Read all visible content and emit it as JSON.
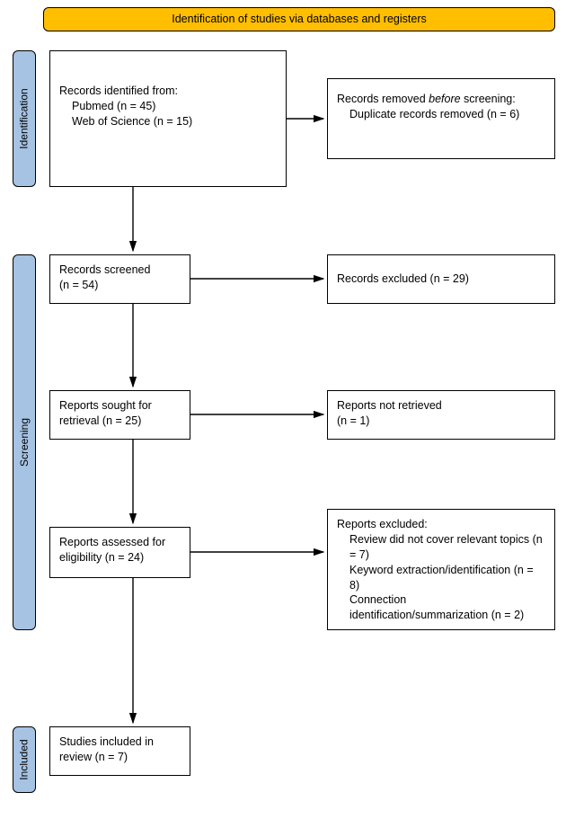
{
  "header": {
    "title": "Identification of studies via databases and registers"
  },
  "stages": {
    "identification": "Identification",
    "screening": "Screening",
    "included": "Included"
  },
  "boxes": {
    "identified": {
      "header": "Records identified from:",
      "line1": "Pubmed (n = 45)",
      "line2": "Web of Science (n = 15)"
    },
    "removed": {
      "line1_prefix": "Records removed ",
      "line1_em": "before",
      "line1_suffix": " screening:",
      "line2": "Duplicate records removed (n = 6)"
    },
    "screened": {
      "text": "Records screened",
      "count": "(n = 54)"
    },
    "excluded_screened": {
      "text": "Records excluded (n = 29)"
    },
    "sought": {
      "text": "Reports sought for retrieval (n = 25)"
    },
    "not_retrieved": {
      "text": "Reports not retrieved",
      "count": "(n = 1)"
    },
    "assessed": {
      "text": "Reports assessed for eligibility (n = 24)"
    },
    "excluded_assessed": {
      "header": "Reports excluded:",
      "r1": "Review did not cover relevant topics (n = 7)",
      "r2": "Keyword extraction/identification (n = 8)",
      "r3": "Connection identification/summarization (n = 2)"
    },
    "included": {
      "text": "Studies included in review (n = 7)"
    }
  },
  "chart_data": {
    "type": "diagram",
    "diagram_type": "PRISMA flow diagram",
    "title": "Identification of studies via databases and registers",
    "stages": [
      "Identification",
      "Screening",
      "Included"
    ],
    "nodes": [
      {
        "id": "identified",
        "stage": "Identification",
        "label": "Records identified from",
        "sources": [
          {
            "name": "Pubmed",
            "n": 45
          },
          {
            "name": "Web of Science",
            "n": 15
          }
        ]
      },
      {
        "id": "removed_before_screening",
        "stage": "Identification",
        "label": "Records removed before screening: Duplicate records removed",
        "n": 6
      },
      {
        "id": "screened",
        "stage": "Screening",
        "label": "Records screened",
        "n": 54
      },
      {
        "id": "excluded_screened",
        "stage": "Screening",
        "label": "Records excluded",
        "n": 29
      },
      {
        "id": "sought",
        "stage": "Screening",
        "label": "Reports sought for retrieval",
        "n": 25
      },
      {
        "id": "not_retrieved",
        "stage": "Screening",
        "label": "Reports not retrieved",
        "n": 1
      },
      {
        "id": "assessed",
        "stage": "Screening",
        "label": "Reports assessed for eligibility",
        "n": 24
      },
      {
        "id": "excluded_assessed",
        "stage": "Screening",
        "label": "Reports excluded",
        "reasons": [
          {
            "reason": "Review did not cover relevant topics",
            "n": 7
          },
          {
            "reason": "Keyword extraction/identification",
            "n": 8
          },
          {
            "reason": "Connection identification/summarization",
            "n": 2
          }
        ]
      },
      {
        "id": "included",
        "stage": "Included",
        "label": "Studies included in review",
        "n": 7
      }
    ],
    "edges": [
      {
        "from": "identified",
        "to": "removed_before_screening"
      },
      {
        "from": "identified",
        "to": "screened"
      },
      {
        "from": "screened",
        "to": "excluded_screened"
      },
      {
        "from": "screened",
        "to": "sought"
      },
      {
        "from": "sought",
        "to": "not_retrieved"
      },
      {
        "from": "sought",
        "to": "assessed"
      },
      {
        "from": "assessed",
        "to": "excluded_assessed"
      },
      {
        "from": "assessed",
        "to": "included"
      }
    ]
  }
}
